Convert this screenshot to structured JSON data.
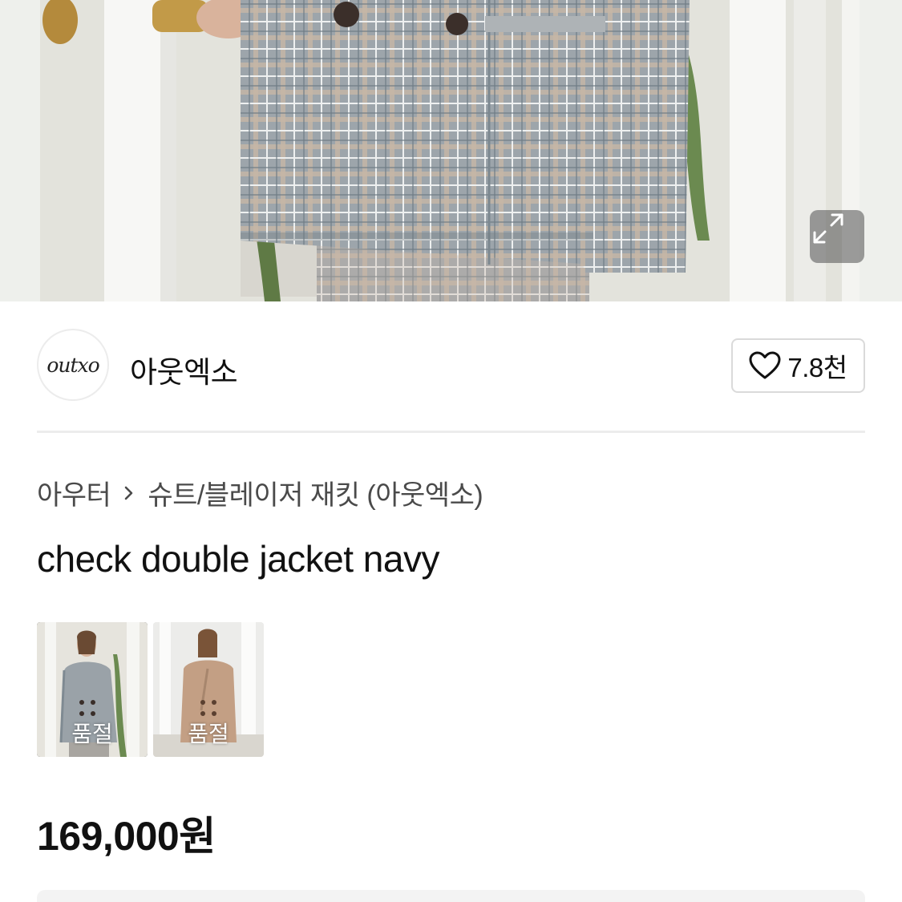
{
  "hero": {
    "expand_icon": "expand-diagonal-icon"
  },
  "brand": {
    "logo_text": "outxo",
    "name": "아웃엑소",
    "like_icon": "heart-outline-icon",
    "like_count": "7.8천"
  },
  "breadcrumb": {
    "category": "아우터",
    "separator_icon": "chevron-right-icon",
    "subcategory": "슈트/블레이저 재킷 (아웃엑소)"
  },
  "product": {
    "title": "check double jacket navy",
    "price": "169,000원"
  },
  "variants": [
    {
      "status": "품절",
      "selected": true
    },
    {
      "status": "품절",
      "selected": false
    }
  ]
}
